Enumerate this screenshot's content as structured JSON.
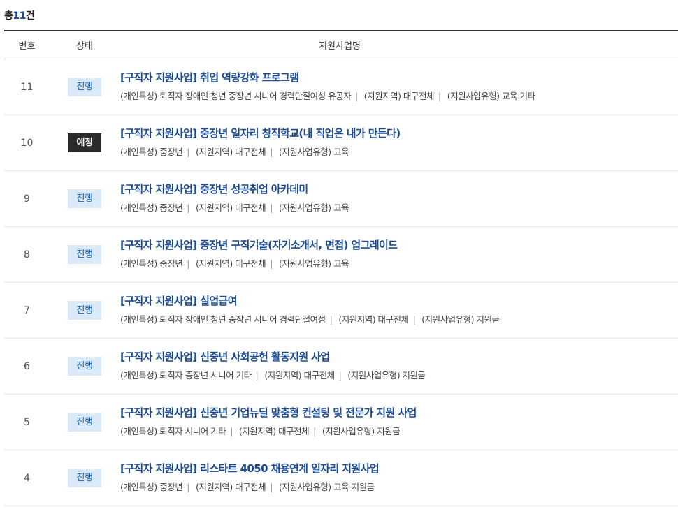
{
  "summary": {
    "prefix": "총",
    "count": "11",
    "suffix": "건"
  },
  "table": {
    "headers": {
      "number": "번호",
      "status": "상태",
      "title": "지원사업명"
    },
    "rows": [
      {
        "number": "11",
        "status": "진행",
        "status_type": "ongoing",
        "title": "[구직자 지원사업] 취업 역량강화 프로그램",
        "meta": [
          "(개인특성) 퇴직자 장애인 청년 중장년 시니어 경력단절여성 유공자",
          "(지원지역) 대구전체",
          "(지원사업유형) 교육 기타"
        ]
      },
      {
        "number": "10",
        "status": "예정",
        "status_type": "planned",
        "title": "[구직자 지원사업] 중장년 일자리 창직학교(내 직업은 내가 만든다)",
        "meta": [
          "(개인특성) 중장년",
          "(지원지역) 대구전체",
          "(지원사업유형) 교육"
        ]
      },
      {
        "number": "9",
        "status": "진행",
        "status_type": "ongoing",
        "title": "[구직자 지원사업] 중장년 성공취업 아카데미",
        "meta": [
          "(개인특성) 중장년",
          "(지원지역) 대구전체",
          "(지원사업유형) 교육"
        ]
      },
      {
        "number": "8",
        "status": "진행",
        "status_type": "ongoing",
        "title": "[구직자 지원사업] 중장년 구직기술(자기소개서, 면접) 업그레이드",
        "meta": [
          "(개인특성) 중장년",
          "(지원지역) 대구전체",
          "(지원사업유형) 교육"
        ]
      },
      {
        "number": "7",
        "status": "진행",
        "status_type": "ongoing",
        "title": "[구직자 지원사업] 실업급여",
        "meta": [
          "(개인특성) 퇴직자 장애인 청년 중장년 시니어 경력단절여성",
          "(지원지역) 대구전체",
          "(지원사업유형) 지원금"
        ]
      },
      {
        "number": "6",
        "status": "진행",
        "status_type": "ongoing",
        "title": "[구직자 지원사업] 신중년 사회공헌 활동지원 사업",
        "meta": [
          "(개인특성) 퇴직자 중장년 시니어 기타",
          "(지원지역) 대구전체",
          "(지원사업유형) 지원금"
        ]
      },
      {
        "number": "5",
        "status": "진행",
        "status_type": "ongoing",
        "title": "[구직자 지원사업] 신중년 기업뉴딜 맞춤형 컨설팅 및 전문가 지원 사업",
        "meta": [
          "(개인특성) 퇴직자 시니어 기타",
          "(지원지역) 대구전체",
          "(지원사업유형) 지원금"
        ]
      },
      {
        "number": "4",
        "status": "진행",
        "status_type": "ongoing",
        "title": "[구직자 지원사업] 리스타트 4050 채용연계 일자리 지원사업",
        "meta": [
          "(개인특성) 중장년",
          "(지원지역) 대구전체",
          "(지원사업유형) 교육 지원금"
        ]
      }
    ]
  },
  "colors": {
    "accent": "#1a4a94",
    "ongoing_bg": "#dbeaf9",
    "ongoing_text": "#1a5fb4",
    "planned_bg": "#2b2b2b",
    "planned_text": "#ffffff"
  }
}
